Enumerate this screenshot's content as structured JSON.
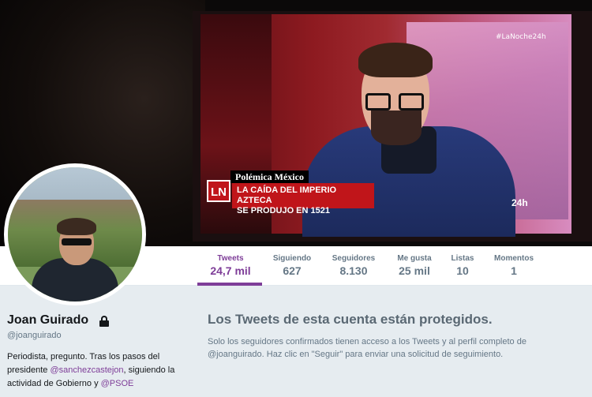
{
  "banner": {
    "tv_hashtag": "#LaNoche24h",
    "lower_third_title": "Polémica México",
    "lower_third_logo": "LN",
    "lower_third_line1": "LA CAÍDA DEL IMPERIO AZTECA",
    "lower_third_line2": "SE PRODUJO EN 1521",
    "channel_logo": "24h"
  },
  "nav": {
    "items": [
      {
        "label": "Tweets",
        "value": "24,7 mil"
      },
      {
        "label": "Siguiendo",
        "value": "627"
      },
      {
        "label": "Seguidores",
        "value": "8.130"
      },
      {
        "label": "Me gusta",
        "value": "25 mil"
      },
      {
        "label": "Listas",
        "value": "10"
      },
      {
        "label": "Momentos",
        "value": "1"
      }
    ]
  },
  "profile": {
    "name": "Joan Guirado",
    "handle": "@joanguirado",
    "bio_part1": "Periodista, pregunto. Tras los pasos del presidente ",
    "bio_mention1": "@sanchezcastejon",
    "bio_part2": ", siguiendo la actividad de Gobierno y ",
    "bio_mention2": "@PSOE"
  },
  "protected": {
    "title": "Los Tweets de esta cuenta están protegidos.",
    "text": "Solo los seguidores confirmados tienen acceso a los Tweets y al perfil completo de @joanguirado. Haz clic en \"Seguir\" para enviar una solicitud de seguimiento."
  },
  "colors": {
    "accent": "#7e3d98",
    "background": "#e6ecf0"
  }
}
